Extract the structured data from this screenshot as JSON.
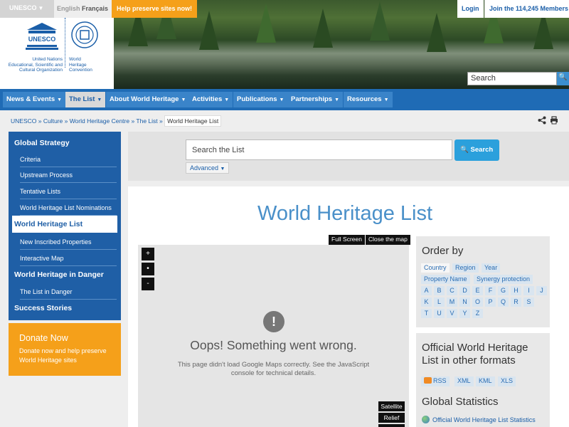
{
  "topbar": {
    "unesco_label": "UNESCO",
    "lang_english": "English",
    "lang_french": "Français",
    "help_label": "Help preserve sites now!",
    "login_label": "Login",
    "join_label": "Join the 114,245 Members"
  },
  "header": {
    "unesco_logo": "UNESCO",
    "un_text": [
      "United Nations",
      "Educational, Scientific and",
      "Cultural Organization"
    ],
    "whc_text": [
      "World",
      "Heritage",
      "Convention"
    ],
    "search_placeholder": "Search"
  },
  "nav": [
    {
      "label": "News & Events"
    },
    {
      "label": "The List"
    },
    {
      "label": "About World Heritage"
    },
    {
      "label": "Activities"
    },
    {
      "label": "Publications"
    },
    {
      "label": "Partnerships"
    },
    {
      "label": "Resources"
    }
  ],
  "breadcrumb": {
    "items": [
      "UNESCO",
      "Culture",
      "World Heritage Centre",
      "The List"
    ],
    "current": "World Heritage List"
  },
  "sidebar": {
    "global_strategy": "Global Strategy",
    "criteria": "Criteria",
    "upstream": "Upstream Process",
    "tentative": "Tentative Lists",
    "nominations": "World Heritage List Nominations",
    "whl": "World Heritage List",
    "new_inscribed": "New Inscribed Properties",
    "interactive_map": "Interactive Map",
    "danger": "World Heritage in Danger",
    "list_danger": "The List in Danger",
    "success": "Success Stories"
  },
  "donate": {
    "title": "Donate Now",
    "desc": "Donate now and help preserve World Heritage sites"
  },
  "list_search": {
    "placeholder": "Search the List",
    "button": "Search",
    "advanced": "Advanced"
  },
  "main": {
    "title": "World Heritage List",
    "full_screen": "Full Screen",
    "close_map": "Close the map"
  },
  "map": {
    "zoom_in": "+",
    "dot": "•",
    "zoom_out": "-",
    "error_icon": "!",
    "error_title": "Oops! Something went wrong.",
    "error_desc": "This page didn't load Google Maps correctly. See the JavaScript console for technical details.",
    "satellite": "Satellite",
    "relief": "Relief"
  },
  "order": {
    "title": "Order by",
    "tags": [
      "Country",
      "Region",
      "Year",
      "Property Name",
      "Synergy protection"
    ],
    "letters": [
      "A",
      "B",
      "C",
      "D",
      "E",
      "F",
      "G",
      "H",
      "I",
      "J",
      "K",
      "L",
      "M",
      "N",
      "O",
      "P",
      "Q",
      "R",
      "S",
      "T",
      "U",
      "V",
      "Y",
      "Z"
    ]
  },
  "formats": {
    "title": "Official World Heritage List in other formats",
    "items": [
      "RSS",
      "XML",
      "KML",
      "XLS"
    ],
    "stats_title": "Global Statistics",
    "stats_link": "Official World Heritage List Statistics"
  },
  "colors": {
    "nav_bg": "#1f6bb5",
    "accent_orange": "#f5a01a",
    "title_blue": "#4a90c9",
    "search_btn": "#2ba0dc"
  }
}
